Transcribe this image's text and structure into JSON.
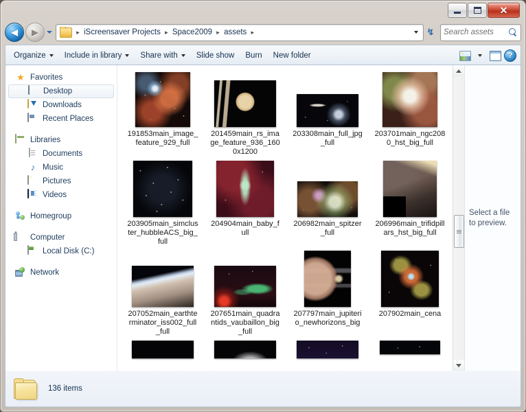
{
  "window": {
    "controls": {
      "minimize": "Minimize",
      "maximize": "Maximize",
      "close": "Close",
      "close_glyph": "✕"
    }
  },
  "navigation": {
    "back_label": "Back",
    "forward_label": "Forward",
    "back_glyph": "◀",
    "forward_glyph": "▶",
    "history_label": "Recent pages",
    "refresh_glyph": "↯",
    "refresh_label": "Refresh"
  },
  "address": {
    "separator": "▸",
    "crumbs": [
      "iScreensaver Projects",
      "Space2009",
      "assets"
    ]
  },
  "search": {
    "placeholder": "Search assets",
    "value": ""
  },
  "toolbar": {
    "items": [
      {
        "label": "Organize",
        "has_caret": true
      },
      {
        "label": "Include in library",
        "has_caret": true
      },
      {
        "label": "Share with",
        "has_caret": true
      },
      {
        "label": "Slide show",
        "has_caret": false
      },
      {
        "label": "Burn",
        "has_caret": false
      },
      {
        "label": "New folder",
        "has_caret": false
      }
    ],
    "view_label": "Change your view",
    "preview_pane_label": "Show the preview pane",
    "help_label": "Get help",
    "help_glyph": "?"
  },
  "sidebar": {
    "groups": [
      {
        "header": {
          "label": "Favorites",
          "icon": "star-icon"
        },
        "items": [
          {
            "label": "Desktop",
            "icon": "desktop-icon",
            "selected": true
          },
          {
            "label": "Downloads",
            "icon": "downloads-icon",
            "selected": false
          },
          {
            "label": "Recent Places",
            "icon": "recent-places-icon",
            "selected": false
          }
        ]
      },
      {
        "header": {
          "label": "Libraries",
          "icon": "libraries-icon"
        },
        "items": [
          {
            "label": "Documents",
            "icon": "documents-icon",
            "selected": false
          },
          {
            "label": "Music",
            "icon": "music-icon",
            "selected": false
          },
          {
            "label": "Pictures",
            "icon": "pictures-icon",
            "selected": false
          },
          {
            "label": "Videos",
            "icon": "videos-icon",
            "selected": false
          }
        ]
      },
      {
        "header": {
          "label": "Homegroup",
          "icon": "homegroup-icon"
        },
        "items": []
      },
      {
        "header": {
          "label": "Computer",
          "icon": "computer-icon"
        },
        "items": [
          {
            "label": "Local Disk (C:)",
            "icon": "local-disk-icon",
            "selected": false
          }
        ]
      },
      {
        "header": {
          "label": "Network",
          "icon": "network-icon"
        },
        "items": []
      }
    ]
  },
  "files": [
    {
      "name": "191853main_image_feature_929_full",
      "w": 80,
      "h": 80,
      "art": "nebula-red"
    },
    {
      "name": "201459main_rs_image_feature_936_1600x1200",
      "w": 90,
      "h": 68,
      "art": "saturn"
    },
    {
      "name": "203308main_full_jpg_full",
      "w": 90,
      "h": 48,
      "art": "galaxies"
    },
    {
      "name": "203701main_ngc2080_hst_big_full",
      "w": 80,
      "h": 80,
      "art": "nebula-ghost"
    },
    {
      "name": "203905main_simcluster_hubbleACS_big_full",
      "w": 86,
      "h": 82,
      "art": "starfield"
    },
    {
      "name": "204904main_baby_full",
      "w": 84,
      "h": 82,
      "art": "baby-star"
    },
    {
      "name": "206982main_spitzer_full",
      "w": 88,
      "h": 52,
      "art": "spitzer"
    },
    {
      "name": "206996main_trifidpillars_hst_big_full",
      "w": 78,
      "h": 82,
      "art": "trifid"
    },
    {
      "name": "207052main_earthterminator_iss002_full_full",
      "w": 90,
      "h": 60,
      "art": "earth-limb"
    },
    {
      "name": "207651main_quadrantids_vaubaillon_big_full",
      "w": 90,
      "h": 60,
      "art": "aurora"
    },
    {
      "name": "207797main_jupiterio_newhorizons_big",
      "w": 68,
      "h": 82,
      "art": "jupiter"
    },
    {
      "name": "207902main_cena",
      "w": 84,
      "h": 82,
      "art": "cena"
    },
    {
      "name": "",
      "w": 90,
      "h": 26,
      "art": "row4-a"
    },
    {
      "name": "",
      "w": 90,
      "h": 26,
      "art": "row4-b"
    },
    {
      "name": "",
      "w": 90,
      "h": 26,
      "art": "row4-c"
    },
    {
      "name": "",
      "w": 88,
      "h": 20,
      "art": "row4-d"
    }
  ],
  "preview": {
    "message": "Select a file to preview."
  },
  "status": {
    "item_count": "136 items"
  },
  "colors": {
    "accent": "#2f6da8",
    "crumb_text": "#16304f",
    "window_frame": "#cfc8c1",
    "close_button": "#c33d27"
  }
}
